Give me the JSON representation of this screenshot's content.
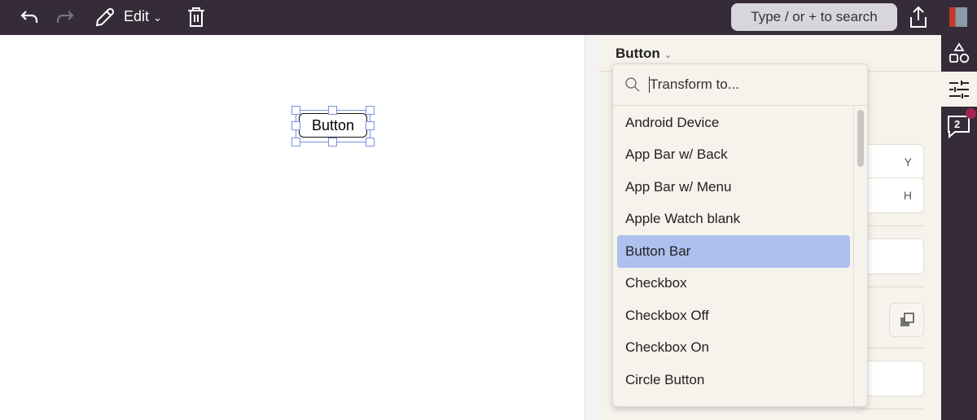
{
  "toolbar": {
    "edit_label": "Edit",
    "search_placeholder": "Type / or + to search"
  },
  "canvas": {
    "selected_element_label": "Button"
  },
  "panel": {
    "title": "Button",
    "field_y": "Y",
    "field_h": "H"
  },
  "transform_menu": {
    "placeholder": "Transform to...",
    "items": [
      "Android Device",
      "App Bar w/ Back",
      "App Bar w/ Menu",
      "Apple Watch blank",
      "Button Bar",
      "Checkbox",
      "Checkbox Off",
      "Checkbox On",
      "Circle Button"
    ],
    "highlighted": "Button Bar"
  },
  "rail": {
    "comments_count": "2"
  },
  "colors": {
    "topbar": "#362b38",
    "highlight": "#adc0ee",
    "badge": "#a0284f"
  }
}
